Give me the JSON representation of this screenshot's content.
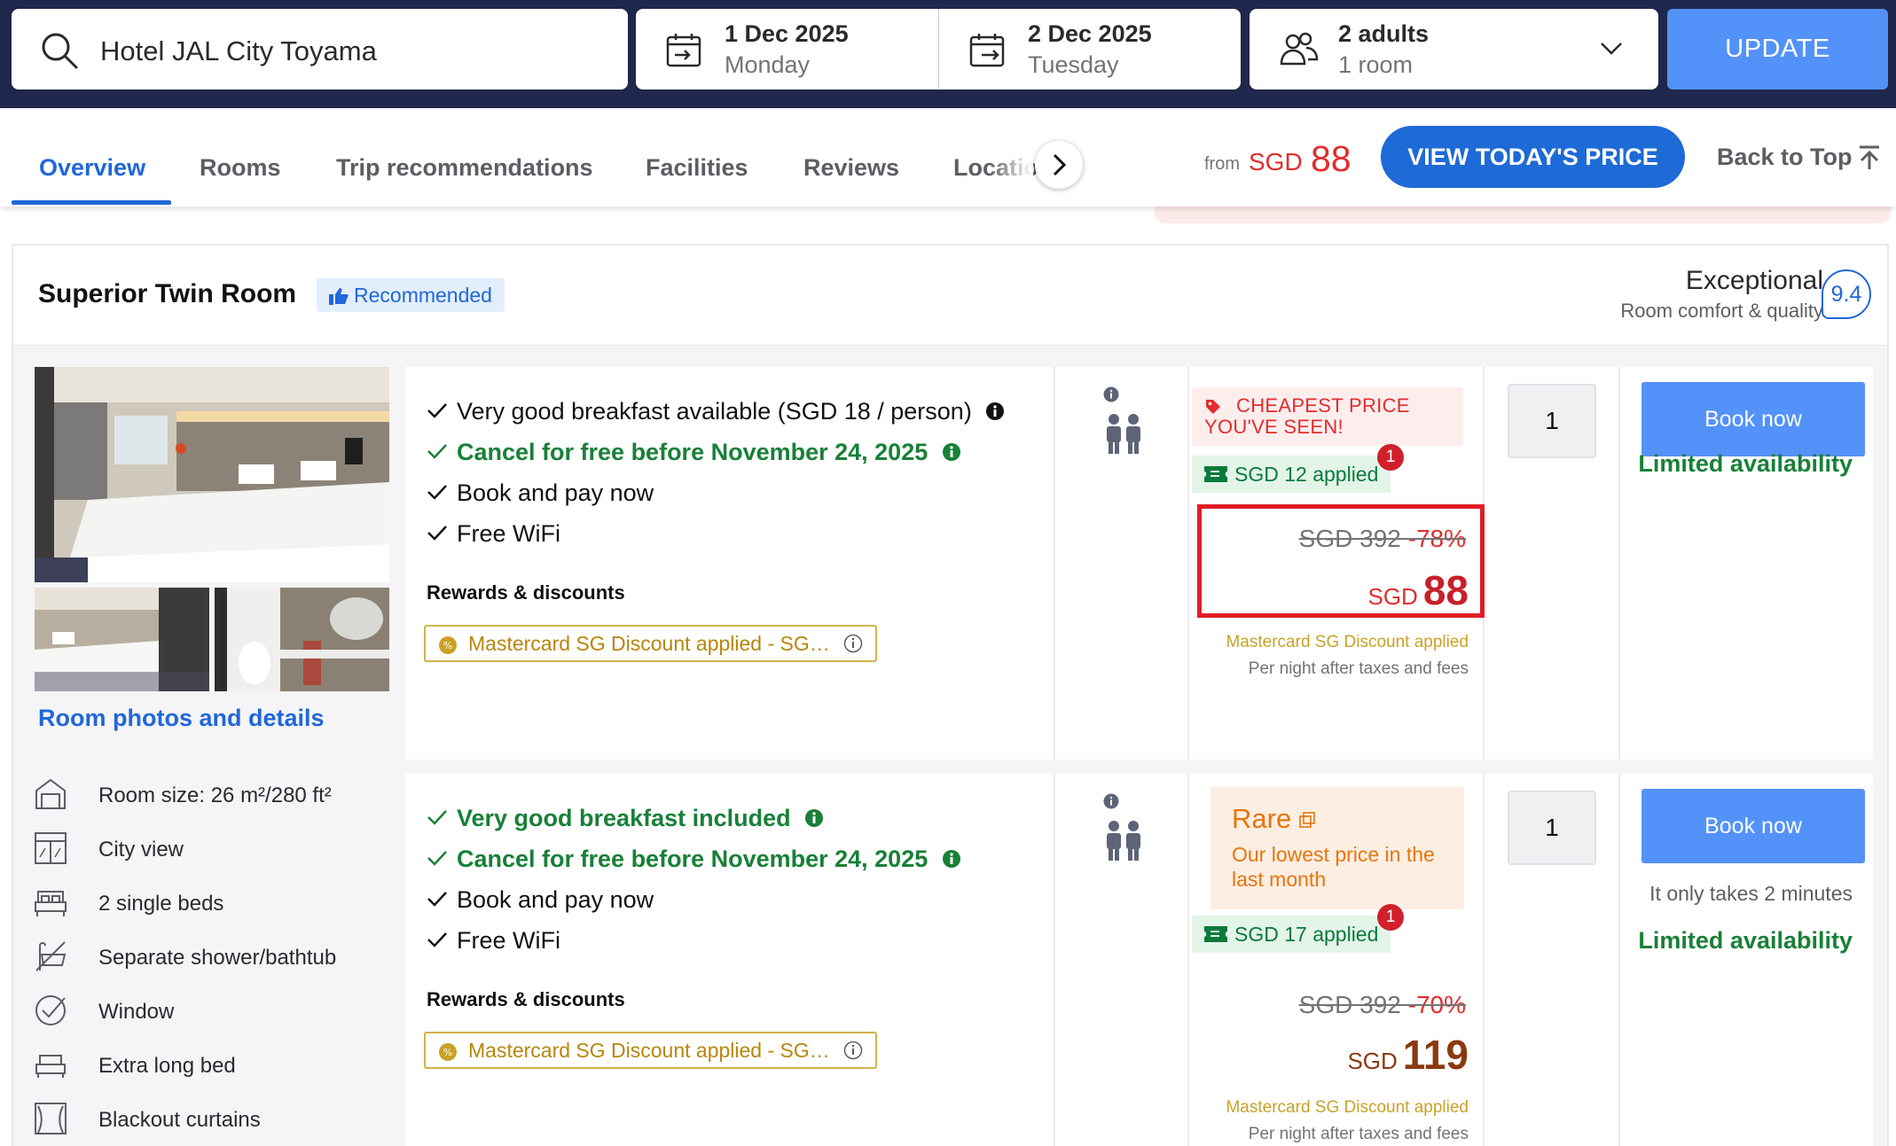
{
  "search": {
    "hotel": "Hotel JAL City Toyama",
    "checkin_date": "1 Dec 2025",
    "checkin_day": "Monday",
    "checkout_date": "2 Dec 2025",
    "checkout_day": "Tuesday",
    "guests": "2 adults",
    "rooms": "1 room",
    "update_label": "UPDATE"
  },
  "nav": {
    "tabs": [
      {
        "label": "Overview",
        "active": true
      },
      {
        "label": "Rooms"
      },
      {
        "label": "Trip recommendations"
      },
      {
        "label": "Facilities"
      },
      {
        "label": "Reviews"
      },
      {
        "label": "Locatio"
      }
    ],
    "from_label": "from",
    "from_currency": "SGD",
    "from_amount": "88",
    "view_price_label": "VIEW TODAY'S PRICE",
    "back_to_top_label": "Back to Top"
  },
  "room": {
    "title": "Superior Twin Room",
    "recommended_label": "Recommended",
    "score_label": "Exceptional",
    "score_sub": "Room comfort & quality",
    "score": "9.4",
    "details_link": "Room photos and details",
    "features": [
      {
        "icon": "room-size-icon",
        "label": "Room size: 26 m²/280 ft²"
      },
      {
        "icon": "city-view-icon",
        "label": "City view"
      },
      {
        "icon": "bed-icon",
        "label": "2 single beds"
      },
      {
        "icon": "shower-icon",
        "label": "Separate shower/bathtub"
      },
      {
        "icon": "window-icon",
        "label": "Window"
      },
      {
        "icon": "long-bed-icon",
        "label": "Extra long bed"
      },
      {
        "icon": "curtains-icon",
        "label": "Blackout curtains"
      }
    ]
  },
  "offers": [
    {
      "benefits": [
        {
          "text": "Very good breakfast available (SGD 18 / person)",
          "green": false,
          "info": true
        },
        {
          "text": "Cancel for free before November 24, 2025",
          "green": true,
          "info": true
        },
        {
          "text": "Book and pay now",
          "green": false,
          "info": false
        },
        {
          "text": "Free WiFi",
          "green": false,
          "info": false
        }
      ],
      "rewards_heading": "Rewards & discounts",
      "discount_chip": "Mastercard SG Discount applied - SG…",
      "cheapest_line1": "CHEAPEST PRICE",
      "cheapest_line2": "YOU'VE SEEN!",
      "applied_label": "SGD 12 applied",
      "applied_count": "1",
      "original_price": "SGD 392",
      "discount_pct": "-78%",
      "currency": "SGD",
      "price": "88",
      "price_note": "Mastercard SG Discount applied",
      "price_sub": "Per night after taxes and fees",
      "quantity": "1",
      "book_label": "Book now",
      "availability": "Limited availability"
    },
    {
      "benefits": [
        {
          "text": "Very good breakfast included",
          "green": true,
          "info": true
        },
        {
          "text": "Cancel for free before November 24, 2025",
          "green": true,
          "info": true
        },
        {
          "text": "Book and pay now",
          "green": false,
          "info": false
        },
        {
          "text": "Free WiFi",
          "green": false,
          "info": false
        }
      ],
      "rewards_heading": "Rewards & discounts",
      "discount_chip": "Mastercard SG Discount applied - SG…",
      "rare_title": "Rare",
      "rare_text": "Our lowest price in the last month",
      "applied_label": "SGD 17 applied",
      "applied_count": "1",
      "original_price": "SGD 392",
      "discount_pct": "-70%",
      "currency": "SGD",
      "price": "119",
      "price_note": "Mastercard SG Discount applied",
      "price_sub": "Per night after taxes and fees",
      "quantity": "1",
      "book_label": "Book now",
      "takes_label": "It only takes 2 minutes",
      "availability": "Limited availability"
    }
  ],
  "colors": {
    "header_bg": "#20274d",
    "accent_blue": "#5392f9",
    "link_blue": "#2067da",
    "price_red": "#e12d2d",
    "success_green": "#188038"
  }
}
